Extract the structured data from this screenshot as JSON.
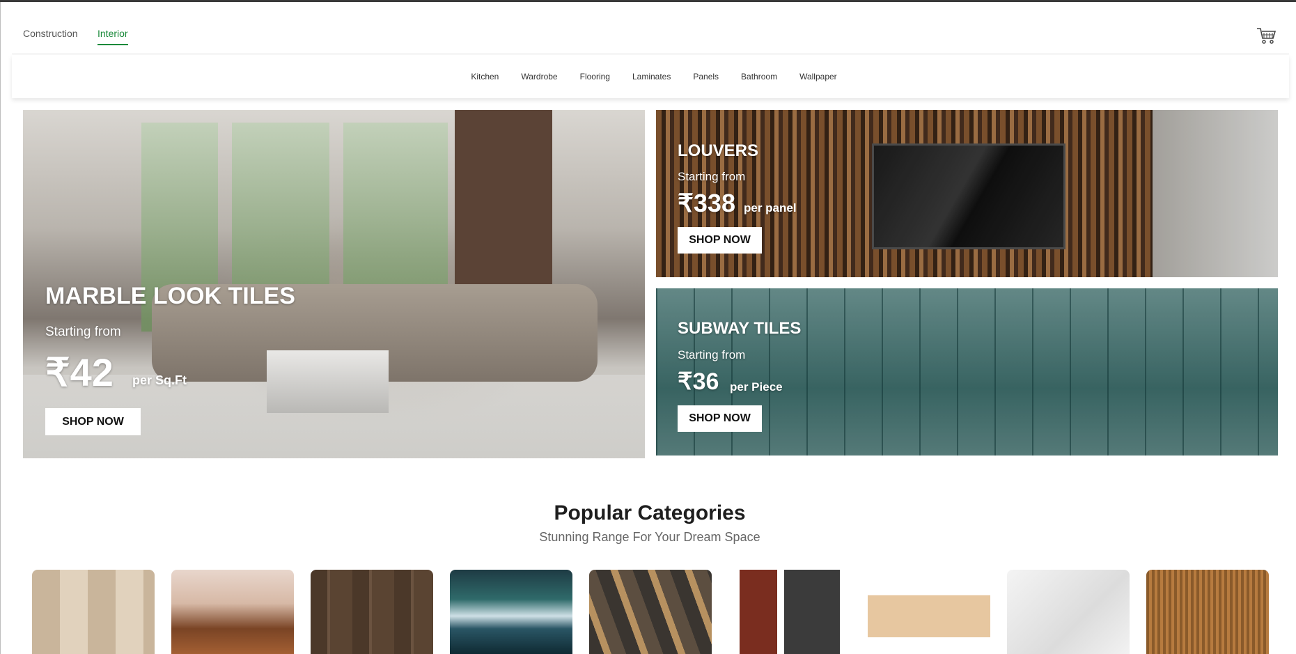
{
  "header": {
    "tabs": [
      {
        "label": "Construction"
      },
      {
        "label": "Interior"
      }
    ],
    "active_tab": "Interior",
    "accent_color": "#1a8a3a"
  },
  "nav": {
    "items": [
      "Kitchen",
      "Wardrobe",
      "Flooring",
      "Laminates",
      "Panels",
      "Bathroom",
      "Wallpaper"
    ]
  },
  "banners": {
    "main": {
      "title": "MARBLE LOOK TILES",
      "subtitle": "Starting from",
      "price": "₹42",
      "unit": "per Sq.Ft",
      "button": "SHOP NOW"
    },
    "louvers": {
      "title": "LOUVERS",
      "subtitle": "Starting from",
      "price": "₹338",
      "unit": "per panel",
      "button": "SHOP NOW"
    },
    "subway": {
      "title": "SUBWAY TILES",
      "subtitle": "Starting from",
      "price": "₹36",
      "unit": "per Piece",
      "button": "SHOP NOW"
    }
  },
  "popular": {
    "title": "Popular Categories",
    "subtitle": "Stunning Range For Your Dream Space"
  },
  "icons": {
    "cart": "cart-icon"
  }
}
